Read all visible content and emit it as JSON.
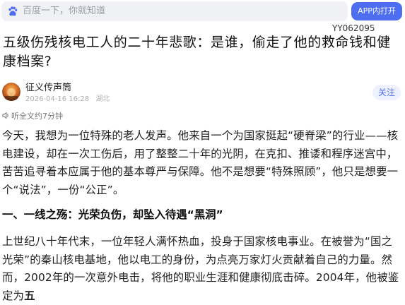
{
  "search": {
    "placeholder": "百度一下，你就知道",
    "app_button_label": "APP内打开"
  },
  "doc_code": "YY062095",
  "article": {
    "title": "五级伤残核电工人的二十年悲歌：是谁，偷走了他的救命钱和健康档案?",
    "author": {
      "name": "征义传声筒",
      "date": "2026-04-16 16:28",
      "location": "湖北",
      "follow_label": "关注"
    },
    "listen_label": "听全文约7分钟",
    "intro_paragraph": "今天，我想为一位特殊的老人发声。他来自一个为国家挺起“硬脊梁”的行业——核电建设，却在一次工伤后，用了整整二十年的光阴，在克扣、推诿和程序迷宫中，苦苦追寻着本应属于他的基本尊严与保障。他不是想要“特殊照顾”，他只是想要一个“说法”，一份“公正”。",
    "section_heading": "一、一线之殇：光荣负伤，却坠入待遇“黑洞”",
    "body_paragraph": "上世纪八十年代末，一位年轻人满怀热血，投身于国家核电事业。在被誉为“国之光荣”的秦山核电基地，他以电工的身份，为点亮万家灯火贡献着自己的力量。然而，2002年的一次意外电击，将他的职业生涯和健康彻底击碎。2004年，他被鉴定为",
    "body_paragraph_bold_tail": "五"
  },
  "colors": {
    "accent": "#4e6ef2",
    "search_bg": "#f0f1f5",
    "follow_bg": "#eef2fe"
  },
  "icons": {
    "logo": "baidu-paw-icon",
    "listen": "speaker-icon",
    "avatar": "avatar-image"
  }
}
